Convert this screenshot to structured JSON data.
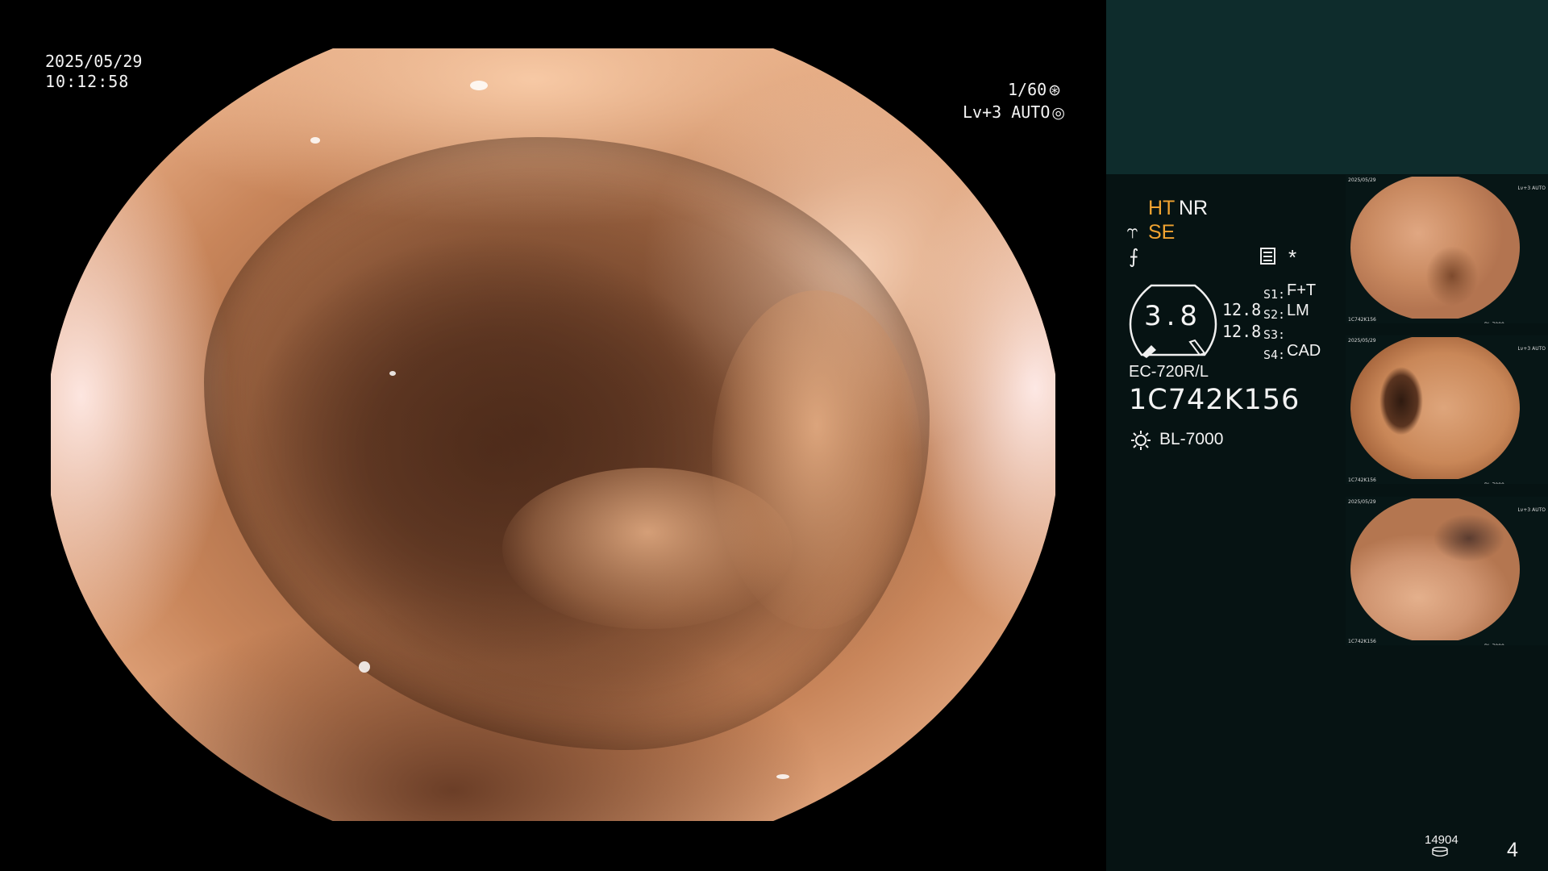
{
  "overlay": {
    "date": "2025/05/29",
    "time": "10:12:58",
    "shutter": "1/60",
    "shutter_icon": "aperture-icon",
    "iris_mode": "Lv+3 AUTO",
    "iris_icon": "iris-icon"
  },
  "enhancement": {
    "ht": "HT",
    "nr": "NR",
    "se": "SE",
    "se_icon": "structure-enhance-icon",
    "freeze_icon": "freeze-icon",
    "star": "*"
  },
  "gauge": {
    "value": "3.8",
    "zoom_1": "12.8",
    "zoom_2": "12.8"
  },
  "switches": [
    {
      "key": "S1:",
      "value": "F+T"
    },
    {
      "key": "S2:",
      "value": "LM"
    },
    {
      "key": "S3:",
      "value": ""
    },
    {
      "key": "S4:",
      "value": "CAD"
    }
  ],
  "scope": {
    "model": "EC-720R/L",
    "serial": "1C742K156",
    "lamp": "BL-7000"
  },
  "footer": {
    "record_count": "14904",
    "page_number": "4"
  },
  "colors": {
    "accent_orange": "#f0a331",
    "panel_dark": "#061313",
    "panel_top": "#0e2c2c"
  }
}
